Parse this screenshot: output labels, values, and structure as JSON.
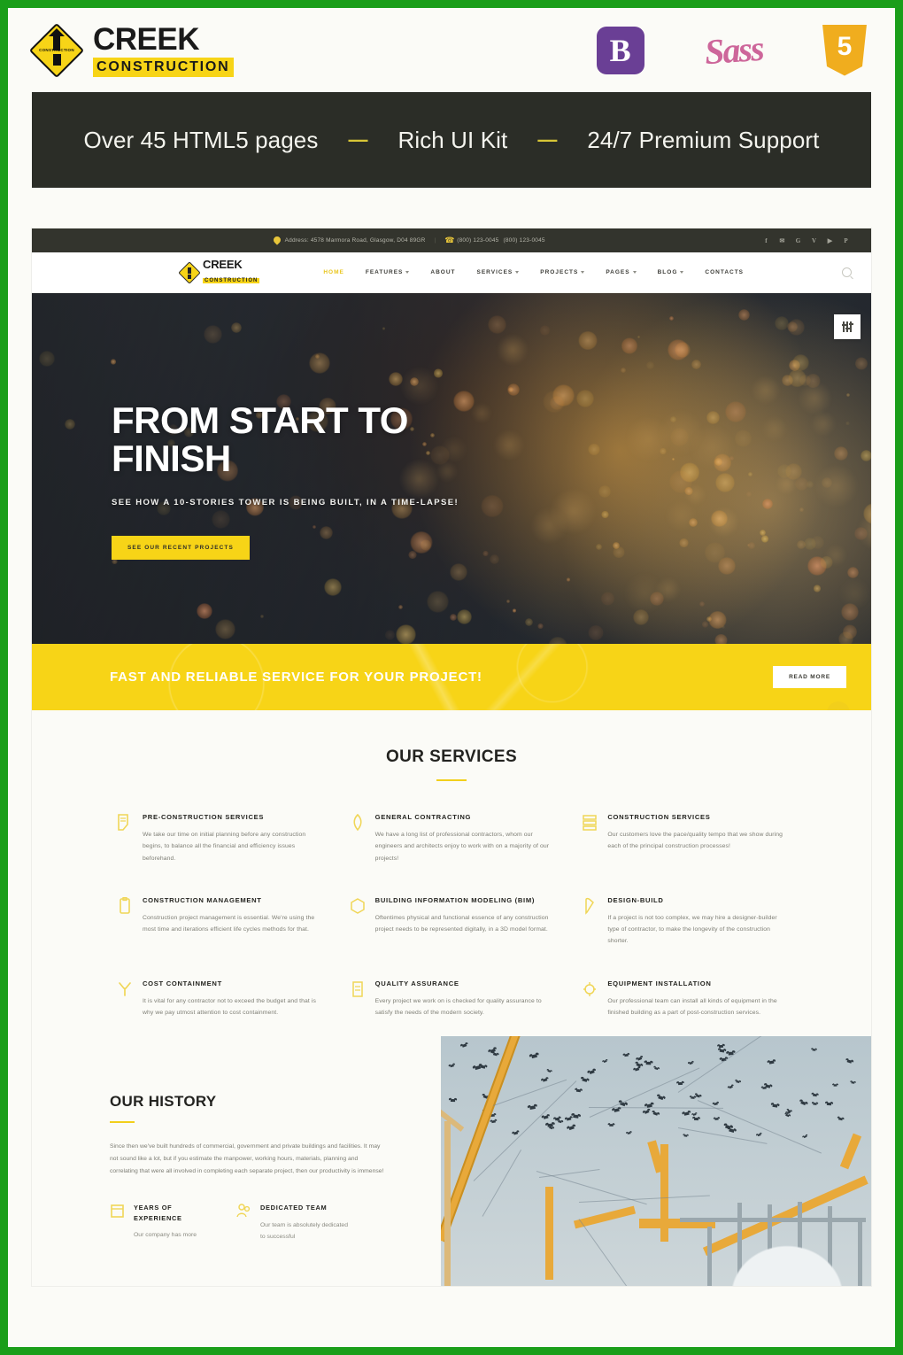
{
  "promo": {
    "brand": {
      "name": "CREEK",
      "subtitle": "CONSTRUCTION",
      "badge_micro": "CONSTRUCTION"
    },
    "tech_badges": [
      {
        "name": "bootstrap-badge",
        "glyph": "B"
      },
      {
        "name": "sass-badge",
        "glyph": "Sass"
      },
      {
        "name": "html5-badge",
        "glyph": "5"
      }
    ],
    "banner": {
      "item1": "Over 45  HTML5 pages",
      "dash1": "—",
      "item2": "Rich UI Kit",
      "dash2": "—",
      "item3": "24/7 Premium Support"
    }
  },
  "site": {
    "topbar": {
      "address": "Address: 4578 Marmora Road, Glasgow, D04 89GR",
      "separator": "|",
      "phone1": "(800) 123-0045",
      "phone2": "(800) 123-0045",
      "socials": [
        {
          "name": "facebook-icon",
          "glyph": "f"
        },
        {
          "name": "twitter-icon",
          "glyph": "✉"
        },
        {
          "name": "google-plus-icon",
          "glyph": "G"
        },
        {
          "name": "vimeo-icon",
          "glyph": "V"
        },
        {
          "name": "youtube-icon",
          "glyph": "▶"
        },
        {
          "name": "pinterest-icon",
          "glyph": "P"
        }
      ]
    },
    "nav": {
      "logo_name": "CREEK",
      "logo_sub": "CONSTRUCTION",
      "items": [
        {
          "label": "HOME",
          "has_caret": false,
          "active": true
        },
        {
          "label": "FEATURES",
          "has_caret": true,
          "active": false
        },
        {
          "label": "ABOUT",
          "has_caret": false,
          "active": false
        },
        {
          "label": "SERVICES",
          "has_caret": true,
          "active": false
        },
        {
          "label": "PROJECTS",
          "has_caret": true,
          "active": false
        },
        {
          "label": "PAGES",
          "has_caret": true,
          "active": false
        },
        {
          "label": "BLOG",
          "has_caret": true,
          "active": false
        },
        {
          "label": "CONTACTS",
          "has_caret": false,
          "active": false
        }
      ]
    },
    "hero": {
      "title": "FROM START TO FINISH",
      "subtitle": "SEE HOW A 10-STORIES TOWER IS BEING BUILT, IN A TIME-LAPSE!",
      "button": "SEE OUR RECENT PROJECTS"
    },
    "cta": {
      "text": "FAST AND RELIABLE SERVICE FOR YOUR PROJECT!",
      "button": "READ MORE",
      "scroll_top_glyph": "↑"
    },
    "services": {
      "title": "OUR SERVICES",
      "items": [
        {
          "icon": "blueprint-icon",
          "title": "PRE-CONSTRUCTION SERVICES",
          "text": "We take our time on initial planning before any construction begins, to balance all the financial and efficiency issues beforehand."
        },
        {
          "icon": "trowel-icon",
          "title": "GENERAL CONTRACTING",
          "text": "We have a long list of professional contractors, whom our engineers and architects enjoy to work with on a majority of our projects!"
        },
        {
          "icon": "bricks-icon",
          "title": "CONSTRUCTION SERVICES",
          "text": "Our customers love the pace/quality tempo that we show during each of the principal construction processes!"
        },
        {
          "icon": "clipboard-icon",
          "title": "CONSTRUCTION MANAGEMENT",
          "text": "Construction project management is essential. We're using the most time and iterations efficient life cycles methods for that."
        },
        {
          "icon": "model-icon",
          "title": "BUILDING INFORMATION MODELING (BIM)",
          "text": "Oftentimes physical and functional essence of any construction project needs to be represented digitally, in a 3D model format."
        },
        {
          "icon": "pencil-ruler-icon",
          "title": "DESIGN-BUILD",
          "text": "If a project is not too complex, we may hire a designer-builder type of contractor, to make the longevity of the construction shorter."
        },
        {
          "icon": "wrench-icon",
          "title": "COST CONTAINMENT",
          "text": "It is vital for any contractor not to exceed the budget and that is why we pay utmost attention to cost containment."
        },
        {
          "icon": "checklist-icon",
          "title": "QUALITY ASSURANCE",
          "text": "Every project we work on is checked for quality assurance to satisfy the needs of the modern society."
        },
        {
          "icon": "gear-install-icon",
          "title": "EQUIPMENT INSTALLATION",
          "text": "Our professional team can install all kinds of equipment in the finished building as a part of post-construction services."
        }
      ]
    },
    "history": {
      "title": "OUR HISTORY",
      "text": "Since then we've built hundreds of commercial, government and private buildings and facilities. It may not sound like a lot, but if you estimate the manpower, working hours, materials, planning and correlating that were all involved in completing each separate project, then our productivity is immense!",
      "features": [
        {
          "icon": "calendar-icon",
          "title": "YEARS OF EXPERIENCE",
          "text": "Our company has more"
        },
        {
          "icon": "team-icon",
          "title": "DEDICATED TEAM",
          "text": "Our team is absolutely dedicated to successful"
        }
      ]
    }
  },
  "colors": {
    "frame_green": "#1a9e1a",
    "brand_yellow": "#f7d417",
    "banner_dark": "#2b2d27",
    "bootstrap_purple": "#6a3f95",
    "sass_pink": "#cd669a",
    "html5_orange": "#f0ad1e"
  }
}
